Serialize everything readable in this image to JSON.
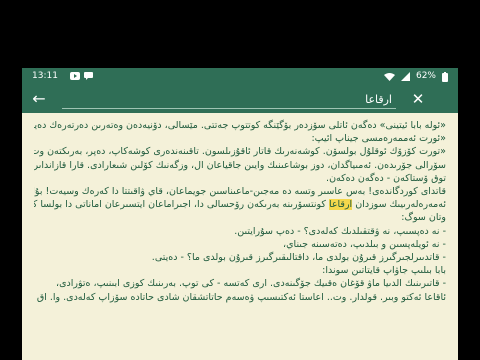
{
  "status": {
    "time": "13:11",
    "battery": "62%",
    "icons": [
      "youtube-icon",
      "chat-icon",
      "wifi-icon",
      "signal-icon",
      "battery-icon"
    ]
  },
  "toolbar": {
    "back_icon": "←",
    "search_value": "ارقاعا",
    "close_icon": "✕"
  },
  "content": {
    "lines": [
      "«ئوله بابا ئیتینی» ده‌گەن ئاتلى سۆزدەر بۆگێنگە كوتتوپ جەتتى. مێسالى، دۆنیەدەن وەتەرىن دەرتەرەك دەیاپ،",
      "«ئورت ئەممەرەمسی جیناپ ائیپ:",
      "«تورت كۆزۆك ئوقلۇل بولسۆن. كوشەنەرىك قاتار ئاقۇزىلسون. تاقىنەندەرى كوشەكاپ، دەپر، بەرىكتەن وت",
      "سۆرالى جۆرىدەن. ئەمىیاگدان، دوز بوشاعىنىك وايىن جاقياعان ال، وزگەنىك كۆلىن شىعارادى. قارا قازانداىرىگەدى",
      "توق ۆستاكەن - دەگەن دەكەن.",
      "قاتداى كوردگاندەى! بەس عاسىر وتسە دە مەجىن-ماعىناسىن جويماعان، قاي ۋاقىتتا دا كەرەك وسيەت! بۇل",
      "ئەمەرەلەرىيىك سوزدان ارقاعا كونتسۆرىنە بەرىكەن رۆحسالى دا، اجىراماعان ايتسىرعان اماناتى دا بولسا كەرەك.",
      "وتان سوگ:",
      "- نە دەپسىپ، نە ۋقتقىلدىك كەلەدى؟ - دەپ سۇرايتىن.",
      "- نە ئويلەپسىن و بىلدىپ، دەتەسىنە جىناي،",
      "- قاتدىىرلجىرگىرز قىرۇن بولدى ما، داقتالىقىرگىرز قىرۇن بولدى ما؟ - دەيتى.",
      "بابا بىلىپ جاۋاپ قايتاتىن سوندا:",
      "- قاتىرىنىك الدىيا ماۋ قۆغان ەقىيك جۆگىنەدى. ارى كەتسە - كى توپ. بەرىنىك كوزى ابىنىپ، ەتۋرادى،",
      "ئاقاعا ئەكتو وبىر. قولدار. وت.. اعاستا ئەكتىسىپ ۋەسەم حاتاتشقان شادى حاتادە سۆزاپ كەلەدى. وا. اق وكۆۋعىنىك"
    ],
    "highlight": "ارقاعا"
  }
}
